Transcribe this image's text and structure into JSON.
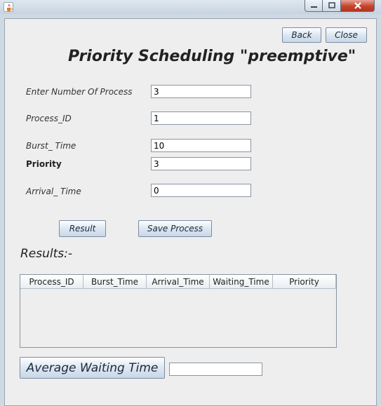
{
  "window": {
    "icon": "java-cup-icon",
    "controls": [
      "minimize-icon",
      "maximize-icon",
      "close-icon"
    ]
  },
  "nav": {
    "back_label": "Back",
    "close_label": "Close"
  },
  "title": "Priority Scheduling \"preemptive\"",
  "form": {
    "num_process_label": "Enter Number Of Process",
    "num_process_value": "3",
    "process_id_label": "Process_ID",
    "process_id_value": "1",
    "burst_time_label": "Burst_ Time",
    "burst_time_value": "10",
    "priority_label": "Priority",
    "priority_value": "3",
    "arrival_time_label": "Arrival_ Time",
    "arrival_time_value": "0"
  },
  "actions": {
    "result_label": "Result",
    "save_label": "Save Process"
  },
  "results_label": "Results:-",
  "table": {
    "columns": [
      "Process_ID",
      "Burst_Time",
      "Arrival_Time",
      "Waiting_Time",
      "Priority"
    ],
    "rows": []
  },
  "average": {
    "button_label": "Average Waiting Time",
    "value": ""
  },
  "colors": {
    "close_button": "#c6442e",
    "background": "#eeeeee",
    "button_face": "#dde7f1"
  }
}
